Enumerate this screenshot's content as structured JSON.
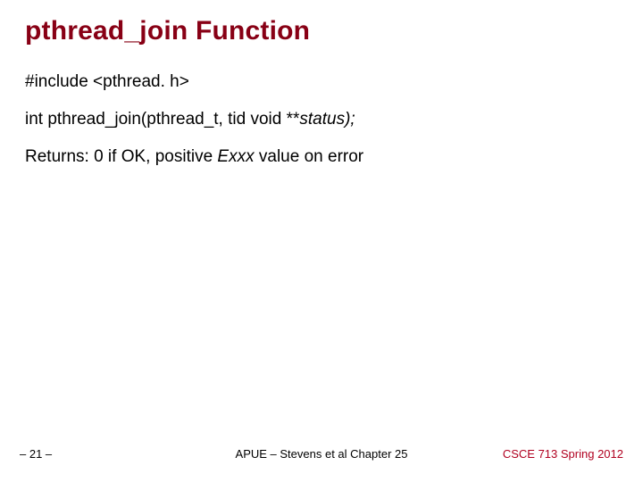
{
  "slide": {
    "title": "pthread_join Function",
    "lines": {
      "include": "#include <pthread. h>",
      "signature_pre": "int pthread_join(pthread_t, tid void  **",
      "signature_italic": "status);",
      "returns_pre": "Returns: 0 if OK, positive ",
      "returns_italic": "Exxx",
      "returns_post": " value on error"
    },
    "footer": {
      "left": "– 21 –",
      "center": "APUE – Stevens et al Chapter 25",
      "right": "CSCE 713 Spring 2012"
    }
  }
}
